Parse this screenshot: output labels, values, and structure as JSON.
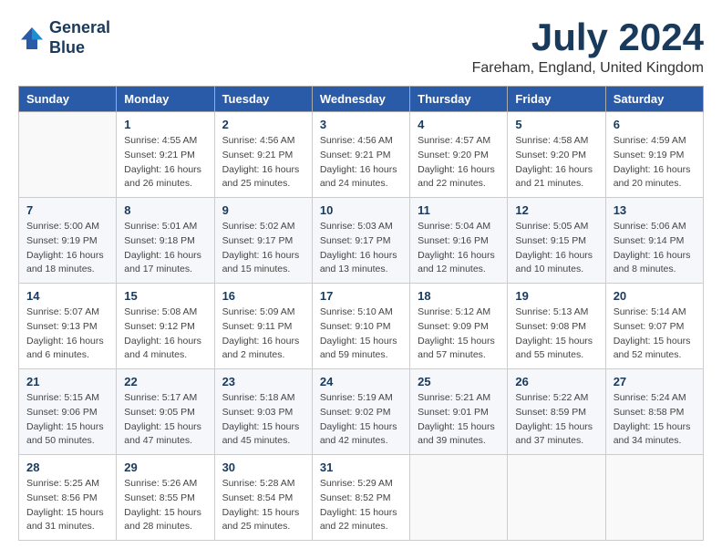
{
  "header": {
    "logo_line1": "General",
    "logo_line2": "Blue",
    "month_title": "July 2024",
    "location": "Fareham, England, United Kingdom"
  },
  "weekdays": [
    "Sunday",
    "Monday",
    "Tuesday",
    "Wednesday",
    "Thursday",
    "Friday",
    "Saturday"
  ],
  "weeks": [
    [
      {
        "day": "",
        "sunrise": "",
        "sunset": "",
        "daylight": ""
      },
      {
        "day": "1",
        "sunrise": "Sunrise: 4:55 AM",
        "sunset": "Sunset: 9:21 PM",
        "daylight": "Daylight: 16 hours and 26 minutes."
      },
      {
        "day": "2",
        "sunrise": "Sunrise: 4:56 AM",
        "sunset": "Sunset: 9:21 PM",
        "daylight": "Daylight: 16 hours and 25 minutes."
      },
      {
        "day": "3",
        "sunrise": "Sunrise: 4:56 AM",
        "sunset": "Sunset: 9:21 PM",
        "daylight": "Daylight: 16 hours and 24 minutes."
      },
      {
        "day": "4",
        "sunrise": "Sunrise: 4:57 AM",
        "sunset": "Sunset: 9:20 PM",
        "daylight": "Daylight: 16 hours and 22 minutes."
      },
      {
        "day": "5",
        "sunrise": "Sunrise: 4:58 AM",
        "sunset": "Sunset: 9:20 PM",
        "daylight": "Daylight: 16 hours and 21 minutes."
      },
      {
        "day": "6",
        "sunrise": "Sunrise: 4:59 AM",
        "sunset": "Sunset: 9:19 PM",
        "daylight": "Daylight: 16 hours and 20 minutes."
      }
    ],
    [
      {
        "day": "7",
        "sunrise": "Sunrise: 5:00 AM",
        "sunset": "Sunset: 9:19 PM",
        "daylight": "Daylight: 16 hours and 18 minutes."
      },
      {
        "day": "8",
        "sunrise": "Sunrise: 5:01 AM",
        "sunset": "Sunset: 9:18 PM",
        "daylight": "Daylight: 16 hours and 17 minutes."
      },
      {
        "day": "9",
        "sunrise": "Sunrise: 5:02 AM",
        "sunset": "Sunset: 9:17 PM",
        "daylight": "Daylight: 16 hours and 15 minutes."
      },
      {
        "day": "10",
        "sunrise": "Sunrise: 5:03 AM",
        "sunset": "Sunset: 9:17 PM",
        "daylight": "Daylight: 16 hours and 13 minutes."
      },
      {
        "day": "11",
        "sunrise": "Sunrise: 5:04 AM",
        "sunset": "Sunset: 9:16 PM",
        "daylight": "Daylight: 16 hours and 12 minutes."
      },
      {
        "day": "12",
        "sunrise": "Sunrise: 5:05 AM",
        "sunset": "Sunset: 9:15 PM",
        "daylight": "Daylight: 16 hours and 10 minutes."
      },
      {
        "day": "13",
        "sunrise": "Sunrise: 5:06 AM",
        "sunset": "Sunset: 9:14 PM",
        "daylight": "Daylight: 16 hours and 8 minutes."
      }
    ],
    [
      {
        "day": "14",
        "sunrise": "Sunrise: 5:07 AM",
        "sunset": "Sunset: 9:13 PM",
        "daylight": "Daylight: 16 hours and 6 minutes."
      },
      {
        "day": "15",
        "sunrise": "Sunrise: 5:08 AM",
        "sunset": "Sunset: 9:12 PM",
        "daylight": "Daylight: 16 hours and 4 minutes."
      },
      {
        "day": "16",
        "sunrise": "Sunrise: 5:09 AM",
        "sunset": "Sunset: 9:11 PM",
        "daylight": "Daylight: 16 hours and 2 minutes."
      },
      {
        "day": "17",
        "sunrise": "Sunrise: 5:10 AM",
        "sunset": "Sunset: 9:10 PM",
        "daylight": "Daylight: 15 hours and 59 minutes."
      },
      {
        "day": "18",
        "sunrise": "Sunrise: 5:12 AM",
        "sunset": "Sunset: 9:09 PM",
        "daylight": "Daylight: 15 hours and 57 minutes."
      },
      {
        "day": "19",
        "sunrise": "Sunrise: 5:13 AM",
        "sunset": "Sunset: 9:08 PM",
        "daylight": "Daylight: 15 hours and 55 minutes."
      },
      {
        "day": "20",
        "sunrise": "Sunrise: 5:14 AM",
        "sunset": "Sunset: 9:07 PM",
        "daylight": "Daylight: 15 hours and 52 minutes."
      }
    ],
    [
      {
        "day": "21",
        "sunrise": "Sunrise: 5:15 AM",
        "sunset": "Sunset: 9:06 PM",
        "daylight": "Daylight: 15 hours and 50 minutes."
      },
      {
        "day": "22",
        "sunrise": "Sunrise: 5:17 AM",
        "sunset": "Sunset: 9:05 PM",
        "daylight": "Daylight: 15 hours and 47 minutes."
      },
      {
        "day": "23",
        "sunrise": "Sunrise: 5:18 AM",
        "sunset": "Sunset: 9:03 PM",
        "daylight": "Daylight: 15 hours and 45 minutes."
      },
      {
        "day": "24",
        "sunrise": "Sunrise: 5:19 AM",
        "sunset": "Sunset: 9:02 PM",
        "daylight": "Daylight: 15 hours and 42 minutes."
      },
      {
        "day": "25",
        "sunrise": "Sunrise: 5:21 AM",
        "sunset": "Sunset: 9:01 PM",
        "daylight": "Daylight: 15 hours and 39 minutes."
      },
      {
        "day": "26",
        "sunrise": "Sunrise: 5:22 AM",
        "sunset": "Sunset: 8:59 PM",
        "daylight": "Daylight: 15 hours and 37 minutes."
      },
      {
        "day": "27",
        "sunrise": "Sunrise: 5:24 AM",
        "sunset": "Sunset: 8:58 PM",
        "daylight": "Daylight: 15 hours and 34 minutes."
      }
    ],
    [
      {
        "day": "28",
        "sunrise": "Sunrise: 5:25 AM",
        "sunset": "Sunset: 8:56 PM",
        "daylight": "Daylight: 15 hours and 31 minutes."
      },
      {
        "day": "29",
        "sunrise": "Sunrise: 5:26 AM",
        "sunset": "Sunset: 8:55 PM",
        "daylight": "Daylight: 15 hours and 28 minutes."
      },
      {
        "day": "30",
        "sunrise": "Sunrise: 5:28 AM",
        "sunset": "Sunset: 8:54 PM",
        "daylight": "Daylight: 15 hours and 25 minutes."
      },
      {
        "day": "31",
        "sunrise": "Sunrise: 5:29 AM",
        "sunset": "Sunset: 8:52 PM",
        "daylight": "Daylight: 15 hours and 22 minutes."
      },
      {
        "day": "",
        "sunrise": "",
        "sunset": "",
        "daylight": ""
      },
      {
        "day": "",
        "sunrise": "",
        "sunset": "",
        "daylight": ""
      },
      {
        "day": "",
        "sunrise": "",
        "sunset": "",
        "daylight": ""
      }
    ]
  ]
}
